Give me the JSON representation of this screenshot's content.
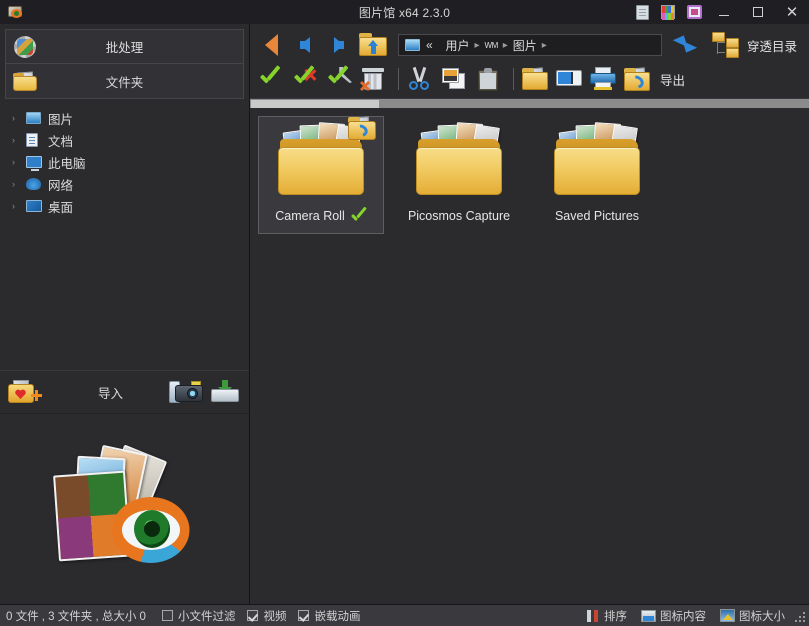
{
  "window": {
    "title": "图片馆 x64 2.3.0",
    "app_icon": "picosmos-logo-icon",
    "titlebar_icons": [
      {
        "name": "document-icon",
        "label": "文档"
      },
      {
        "name": "palette-icon",
        "label": "调色板"
      },
      {
        "name": "monitor-icon",
        "label": "显示"
      }
    ],
    "controls": {
      "minimize": "minimize-button",
      "maximize": "maximize-button",
      "close_label": "✕"
    }
  },
  "sidebar": {
    "buttons": [
      {
        "label": "批处理",
        "icon": "gear-photo-icon",
        "active": true
      },
      {
        "label": "文件夹",
        "icon": "folder-photo-icon",
        "active": false
      }
    ],
    "tree": [
      {
        "label": "图片",
        "icon": "pictures-icon"
      },
      {
        "label": "文档",
        "icon": "documents-icon"
      },
      {
        "label": "此电脑",
        "icon": "this-pc-icon"
      },
      {
        "label": "网络",
        "icon": "network-icon"
      },
      {
        "label": "桌面",
        "icon": "desktop-icon"
      }
    ],
    "chevron": "›",
    "import": {
      "label": "导入",
      "favorite_icon": "favorite-folder-add-icon",
      "camera_icon": "camera-import-icon",
      "disk_icon": "disk-import-icon"
    },
    "logo_alt": "图片馆 眼睛 照片 标志"
  },
  "toolbar": {
    "row1": {
      "back": {
        "name": "back-button",
        "icon": "orange-back-arrow-icon"
      },
      "prev": {
        "name": "previous-button",
        "icon": "blue-left-arrow-icon"
      },
      "next": {
        "name": "next-button",
        "icon": "blue-right-arrow-icon"
      },
      "up": {
        "name": "up-folder-button",
        "icon": "folder-up-icon"
      },
      "refresh": {
        "name": "refresh-button",
        "icon": "refresh-icon"
      },
      "pass_dir": {
        "label": "穿透目录",
        "icon": "folder-tree-icon"
      }
    },
    "breadcrumb": {
      "icon": "pictures-library-icon",
      "overflow": "«",
      "segments": [
        "用户",
        "WM",
        "图片"
      ],
      "separator": "▸"
    },
    "row2": [
      {
        "name": "select-all-button",
        "icon": "green-check-icon",
        "label": ""
      },
      {
        "name": "deselect-button",
        "icon": "check-red-x-icon",
        "label": ""
      },
      {
        "name": "select-options-button",
        "icon": "check-wrench-icon",
        "label": ""
      },
      {
        "name": "delete-button",
        "icon": "trash-icon",
        "label": ""
      },
      {
        "name": "cut-button",
        "icon": "scissors-icon",
        "label": ""
      },
      {
        "name": "copy-button",
        "icon": "copy-icon",
        "label": ""
      },
      {
        "name": "paste-button",
        "icon": "clipboard-icon",
        "label": ""
      },
      {
        "name": "new-folder-button",
        "icon": "folder-icon",
        "label": ""
      },
      {
        "name": "rename-button",
        "icon": "rename-icon",
        "label": ""
      },
      {
        "name": "print-button",
        "icon": "printer-icon",
        "label": ""
      },
      {
        "name": "export-button",
        "icon": "export-folder-icon",
        "label": "导出"
      }
    ],
    "export_label": "导出"
  },
  "content": {
    "items": [
      {
        "label": "Camera Roll",
        "icon": "photo-folder-icon",
        "selected": true,
        "checked": true,
        "badge": "export-badge-icon"
      },
      {
        "label": "Picosmos Capture",
        "icon": "photo-folder-icon",
        "selected": false,
        "checked": false,
        "badge": ""
      },
      {
        "label": "Saved Pictures",
        "icon": "photo-folder-icon",
        "selected": false,
        "checked": false,
        "badge": ""
      }
    ]
  },
  "statusbar": {
    "counts": "0 文件 , 3 文件夹 , 总大小 0",
    "checkboxes": [
      {
        "label": "小文件过滤",
        "checked": false
      },
      {
        "label": "视频",
        "checked": true
      },
      {
        "label": "嵌载动画",
        "checked": true
      }
    ],
    "right_items": [
      {
        "label": "排序",
        "icon": "sort-icon"
      },
      {
        "label": "图标内容",
        "icon": "icon-content-icon"
      },
      {
        "label": "图标大小",
        "icon": "icon-size-icon"
      }
    ],
    "resize_grip": "resize-grip-icon"
  },
  "colors": {
    "window_bg": "#232326",
    "panel_bg": "#2b2b2e",
    "titlebar_bg": "#1f1f23",
    "statusbar_bg": "#3a3a3e",
    "accent_blue": "#1c4f9c",
    "folder_yellow": "#e3aa32",
    "check_green": "#86d42b",
    "selection_bg": "#3a3a3e"
  }
}
